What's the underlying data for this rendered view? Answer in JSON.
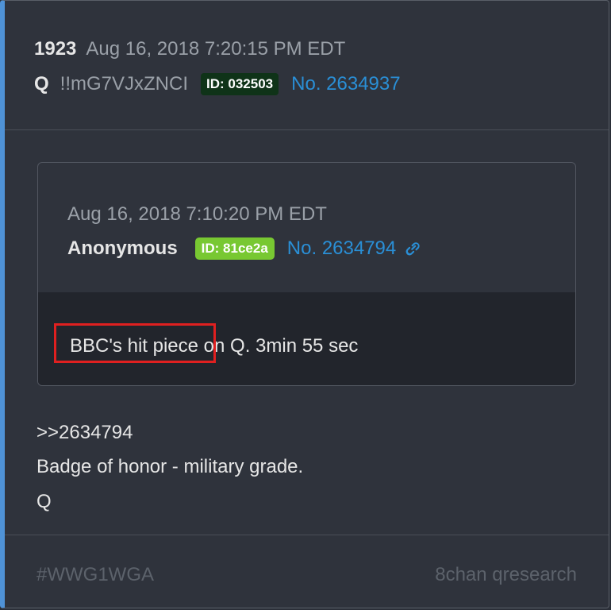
{
  "post": {
    "number": "1923",
    "date": "Aug 16, 2018 7:20:15 PM EDT",
    "author": "Q",
    "tripcode": "!!mG7VJxZNCI",
    "id": "ID: 032503",
    "post_no": "No. 2634937"
  },
  "quoted": {
    "date": "Aug 16, 2018 7:10:20 PM EDT",
    "author": "Anonymous",
    "id": "ID: 81ce2a",
    "post_no": "No. 2634794",
    "text": "BBC's hit piece on Q. 3min 55 sec"
  },
  "body": {
    "line1": ">>2634794",
    "line2": "Badge of honor - military grade.",
    "line3": "Q"
  },
  "footer": {
    "hashtag": "#WWG1WGA",
    "source": "8chan qresearch"
  },
  "colors": {
    "accent_border": "#4f92d6",
    "link": "#2a8fd6",
    "q_id_badge": "#0f3318",
    "anon_id_badge": "#78c832",
    "highlight": "#e02020"
  }
}
